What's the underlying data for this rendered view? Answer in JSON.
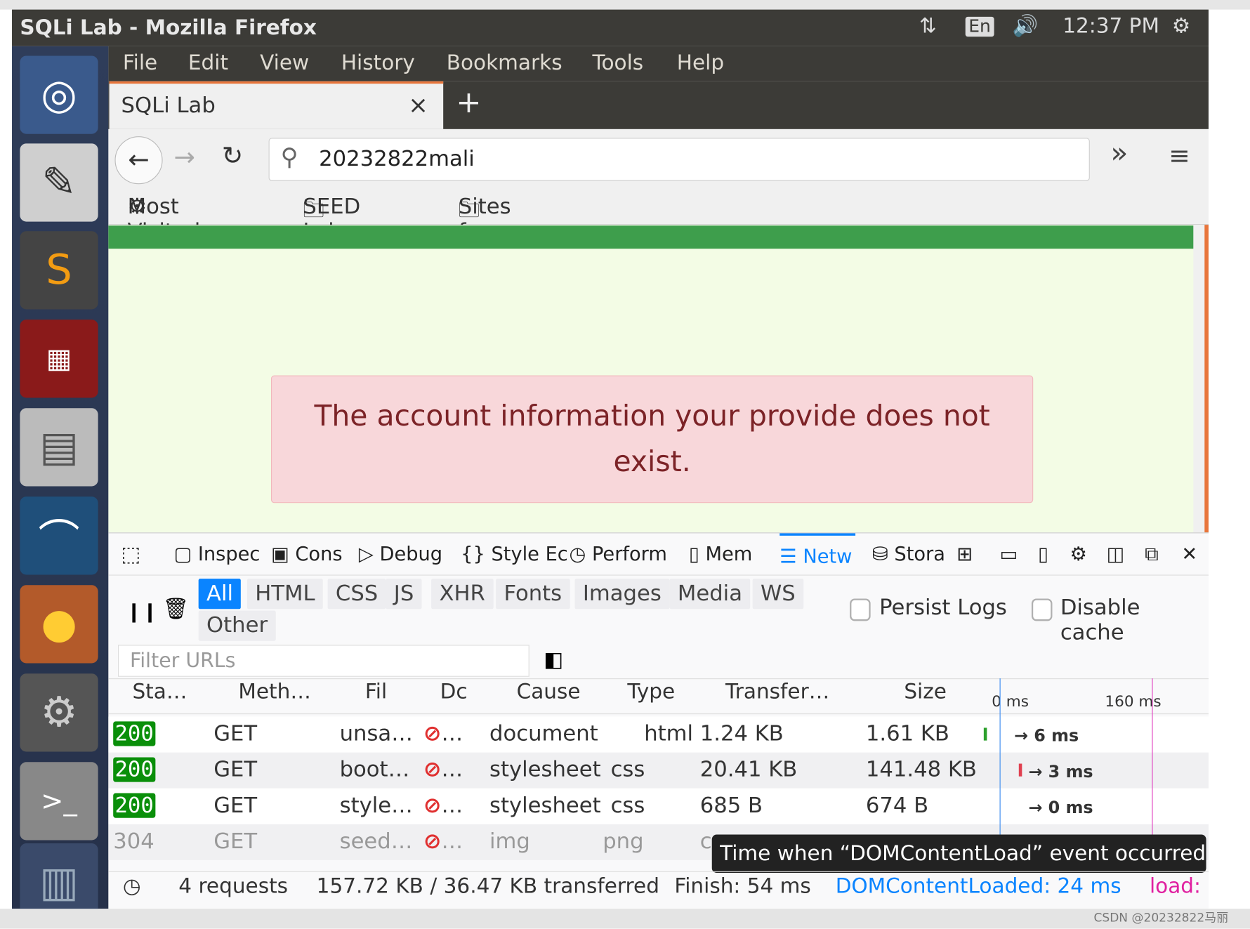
{
  "window": {
    "title": "SQLi Lab - Mozilla Firefox",
    "lang": "En",
    "time": "12:37 PM"
  },
  "launcher": [
    "ubuntu-dash",
    "text-editor",
    "sublime-text",
    "terminal-grid",
    "file-cabinet",
    "wireshark",
    "firefox",
    "system-settings",
    "terminal",
    "trash"
  ],
  "menu": [
    "File",
    "Edit",
    "View",
    "History",
    "Bookmarks",
    "Tools",
    "Help"
  ],
  "tab": {
    "label": "SQLi Lab",
    "close": "×",
    "new": "+"
  },
  "url": "20232822mali",
  "nav": {
    "overflow": "»",
    "menu": "≡"
  },
  "bookmarks": [
    "Most Visited",
    "SEED Labs",
    "Sites for Labs"
  ],
  "page": {
    "message": "The account information your provide does not exist.",
    "colors": {
      "banner": "#3e9e4c",
      "alert_bg": "#f8d7da",
      "alert_text": "#7c2327"
    }
  },
  "devtools": {
    "tools": [
      "Inspec",
      "Cons",
      "Debug",
      "Style Ec",
      "Perform",
      "Mem",
      "Netw",
      "Stora"
    ],
    "active_tool": "Netw",
    "filters": [
      "All",
      "HTML",
      "CSS",
      "JS",
      "XHR",
      "Fonts",
      "Images",
      "Media",
      "WS",
      "Other"
    ],
    "active_filter": "All",
    "persist_logs": "Persist Logs",
    "disable_cache": "Disable cache",
    "filter_placeholder": "Filter URLs",
    "columns": [
      "Sta…",
      "Meth…",
      "Fil",
      "Dc",
      "Cause",
      "Type",
      "Transfer…",
      "Size"
    ],
    "timeline_ticks": [
      "0 ms",
      "160 ms"
    ],
    "rows": [
      {
        "status": "200",
        "method": "GET",
        "file": "unsa…",
        "domain": "…",
        "cause": "document",
        "type": "html",
        "transferred": "1.24 KB",
        "size": "1.61 KB",
        "timing": "→ 6 ms"
      },
      {
        "status": "200",
        "method": "GET",
        "file": "boot…",
        "domain": "…",
        "cause": "stylesheet",
        "type": "css",
        "transferred": "20.41 KB",
        "size": "141.48 KB",
        "timing": "→ 3 ms"
      },
      {
        "status": "200",
        "method": "GET",
        "file": "style…",
        "domain": "…",
        "cause": "stylesheet",
        "type": "css",
        "transferred": "685 B",
        "size": "674 B",
        "timing": "→ 0 ms"
      },
      {
        "status": "304",
        "method": "GET",
        "file": "seed…",
        "domain": "…",
        "cause": "img",
        "type": "png",
        "transferred": "c",
        "size": "",
        "timing": ""
      }
    ],
    "tooltip": "Time when “DOMContentLoad” event occurred",
    "footer": {
      "requests": "4 requests",
      "transferred": "157.72 KB / 36.47 KB transferred",
      "finish": "Finish: 54 ms",
      "dcl": "DOMContentLoaded: 24 ms",
      "load": "load:"
    }
  },
  "watermark": "CSDN @20232822马丽"
}
